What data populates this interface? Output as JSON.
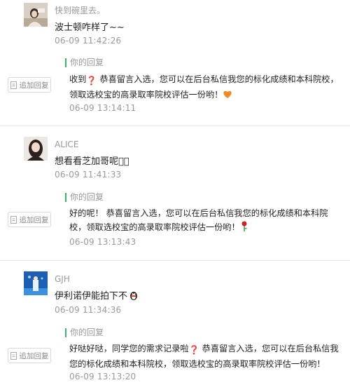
{
  "comments": [
    {
      "username": "快到碗里去。",
      "text": "波士顿咋样了~~",
      "time": "06-09 11:42:26",
      "reply_button": "追加回复",
      "reply_label": "你的回复",
      "reply_text_a": "收到",
      "reply_text_b": " 恭喜留言入选，您可以在后台私信我您的标化成绩和本科院校，领取选校宝的高录取率院校评估一份哟！",
      "reply_time": "06-09 13:14:11"
    },
    {
      "username": "ALICE",
      "text": "想看看芝加哥呢􀀀􀀀",
      "time": "06-09 11:41:33",
      "reply_button": "追加回复",
      "reply_label": "你的回复",
      "reply_text_a": "好的呢！ 恭喜留言入选，您可以在后台私信我您的标化成绩和本科院校，领取选校宝的高录取率院校评估一份哟！",
      "reply_time": "06-09 13:13:43"
    },
    {
      "username": "GJH",
      "text": "伊利诺伊能拍下不",
      "time": "06-09 11:34:36",
      "reply_button": "追加回复",
      "reply_label": "你的回复",
      "reply_text_a": "好哒好哒，同学您的需求记录啦",
      "reply_text_b": " 恭喜留言入选，您可以在后台私信我您的标化成绩和本科院校，领取选校宝的高录取率院校评估一份哟！",
      "reply_time": "06-09 13:13:20"
    }
  ],
  "colors": {
    "accent": "#3cb371",
    "muted": "#999999"
  }
}
